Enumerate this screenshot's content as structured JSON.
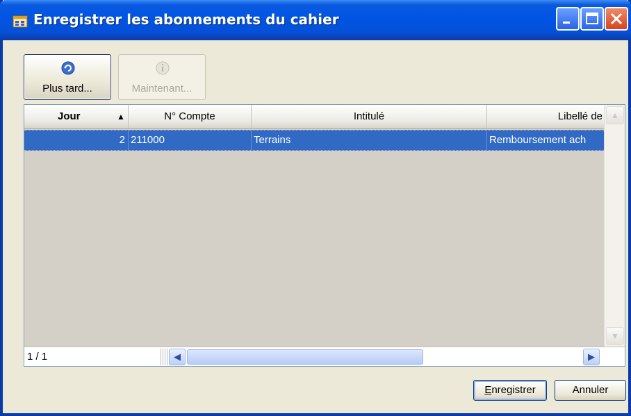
{
  "window": {
    "title": "Enregistrer les abonnements du cahier"
  },
  "toolbar": {
    "later_label": "Plus tard...",
    "now_label": "Maintenant..."
  },
  "grid": {
    "columns": [
      "Jour",
      "N° Compte",
      "Intitulé",
      "Libellé de"
    ],
    "rows": [
      {
        "jour": "2",
        "compte": "211000",
        "intitule": "Terrains",
        "libelle": "Remboursement ach"
      }
    ],
    "pager": "1 / 1"
  },
  "dialog": {
    "save_first_letter": "E",
    "save_rest": "nregistrer",
    "cancel_label": "Annuler"
  },
  "colors": {
    "titlebar": "#0054e3",
    "selection": "#316ac5",
    "close_button": "#d8431c"
  }
}
